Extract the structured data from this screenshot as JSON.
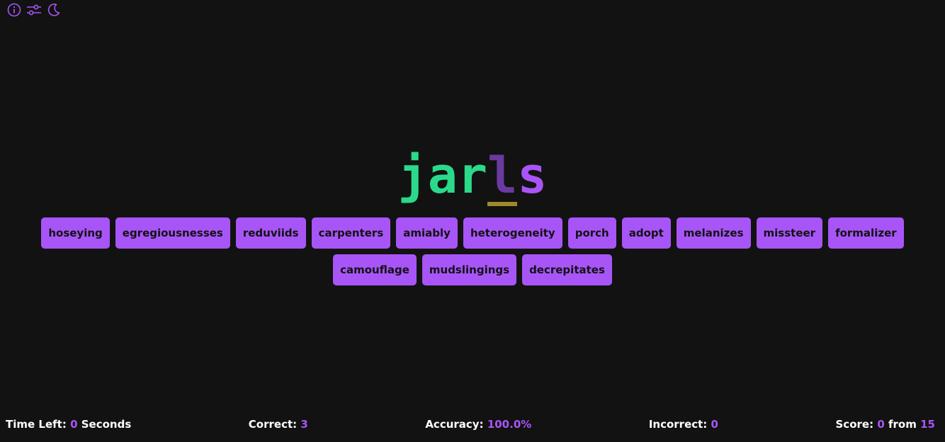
{
  "toolbar": {
    "icons": [
      "info-icon",
      "sliders-icon",
      "moon-icon"
    ],
    "accent": "#a855f7"
  },
  "current_word": {
    "typed": "jar",
    "current": "l",
    "remaining": "s",
    "typed_color": "#2bd98b",
    "remaining_color": "#a855f7"
  },
  "words": [
    "hoseying",
    "egregiousnesses",
    "reduviids",
    "carpenters",
    "amiably",
    "heterogeneity",
    "porch",
    "adopt",
    "melanizes",
    "missteer",
    "formalizer",
    "camouflage",
    "mudslingings",
    "decrepitates"
  ],
  "stats": {
    "time_label": "Time Left:",
    "time_value": "0",
    "time_unit": "Seconds",
    "correct_label": "Correct:",
    "correct_value": "3",
    "accuracy_label": "Accuracy:",
    "accuracy_value": "100.0%",
    "incorrect_label": "Incorrect:",
    "incorrect_value": "0",
    "score_label": "Score:",
    "score_value": "0",
    "score_from": "from",
    "score_total": "15"
  }
}
